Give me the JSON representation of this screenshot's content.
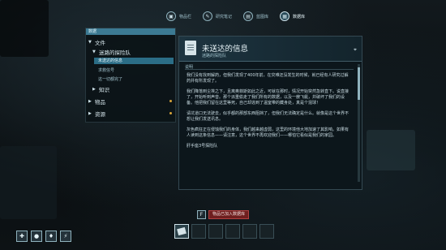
{
  "top_tabs": [
    {
      "label": "物品栏",
      "icon": "backpack-icon",
      "active": false
    },
    {
      "label": "研究笔记",
      "icon": "research-icon",
      "active": false
    },
    {
      "label": "蓝图库",
      "icon": "blueprint-icon",
      "active": false
    },
    {
      "label": "数据库",
      "icon": "database-icon",
      "active": true
    }
  ],
  "left_panel": {
    "title": "数据",
    "tree": [
      {
        "label": "文件",
        "expanded": true,
        "level": 0
      },
      {
        "label": "迷路的探险队",
        "expanded": true,
        "level": 1
      },
      {
        "label": "未送达的信息",
        "level": 2,
        "selected": true
      },
      {
        "label": "求救信号",
        "level": 2
      },
      {
        "label": "这一切都完了",
        "level": 2
      },
      {
        "label": "知识",
        "expanded": false,
        "level": 1
      },
      {
        "label": "物品",
        "expanded": false,
        "level": 0,
        "dot": true
      },
      {
        "label": "资源",
        "expanded": false,
        "level": 0,
        "dot": true
      }
    ]
  },
  "entry": {
    "title": "未送达的信息",
    "subtitle": "迷路的探险队",
    "section_label": "说明",
    "paragraphs": [
      "我们没有找到解药，但我们发现了400年前，在灾难还没发生的时候，就已经有人研究过解药并有所发现了。",
      "我们降落到尘埃之下，且离奥菲斯如此之近，可就在那时，情况开始突然急转直下。说直接了，开始听到声音。那个派重偷走了我们所有的数据，以及一艘飞艇，并破坏了我们的设备。他把我们留在这里等死，自己却逃到了温室带的藏身处，真是个混球！",
      "请坑道口无法驶去，似乎都的那部东西阻挡了，但我们无法确定是什么。就像是这个世界不想让我们发送讯息。",
      "灰色疯狂正在侵蚀我们的身体，我们越来越虚弱，这里的环境他大地加速了其影响。如果有人读到这条信息——请注意，这个世界不再欢迎我们——哪怕它看似是我们的家园。",
      "肝手座3号探险队"
    ]
  },
  "notice": {
    "key": "F",
    "text": "物品已加入数据库"
  },
  "hotbar_slots": 6,
  "status_icons": [
    "health-icon",
    "food-icon",
    "water-icon",
    "energy-icon"
  ]
}
